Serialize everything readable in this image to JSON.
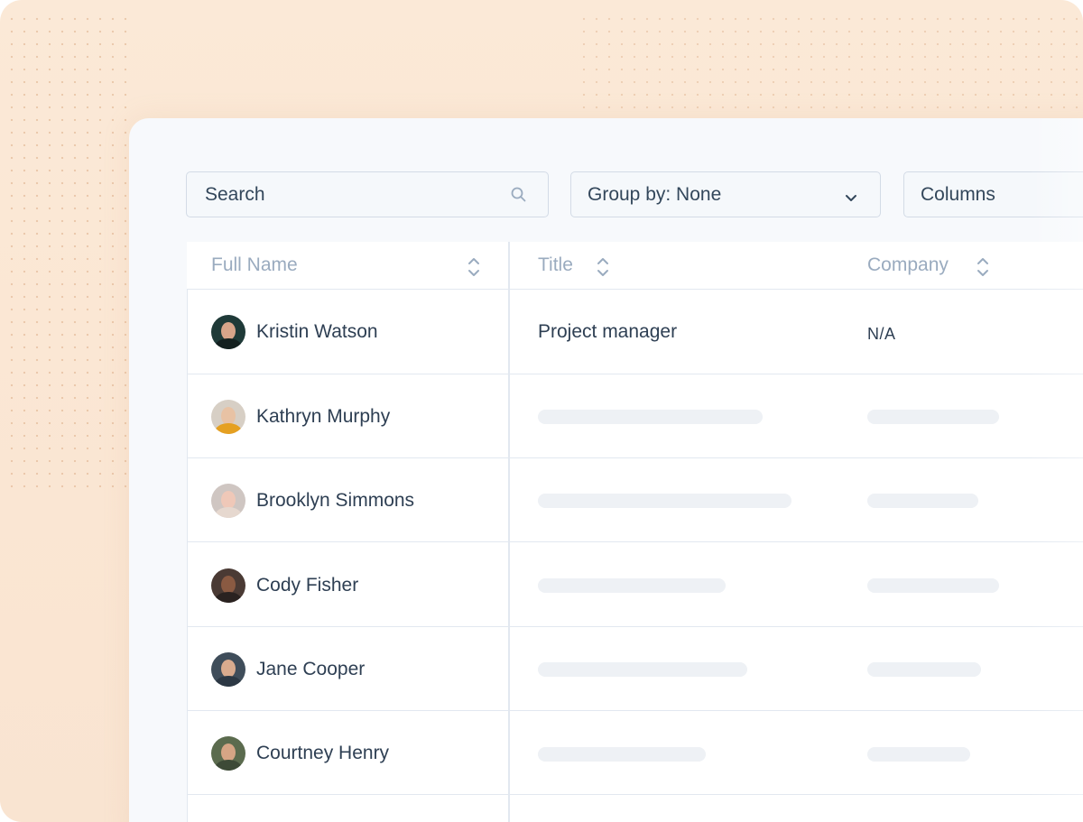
{
  "toolbar": {
    "search_label": "Search",
    "group_by_label": "Group by: None",
    "columns_label": "Columns"
  },
  "table": {
    "headers": [
      "Full Name",
      "Title",
      "Company"
    ],
    "rows": [
      {
        "name": "Kristin Watson",
        "title": "Project manager",
        "company": "N/A"
      },
      {
        "name": "Kathryn Murphy",
        "title": "",
        "company": ""
      },
      {
        "name": "Brooklyn Simmons",
        "title": "",
        "company": ""
      },
      {
        "name": "Cody Fisher",
        "title": "",
        "company": ""
      },
      {
        "name": "Jane Cooper",
        "title": "",
        "company": ""
      },
      {
        "name": "Courtney Henry",
        "title": "",
        "company": ""
      }
    ]
  },
  "colors": {
    "background": "#fbe9d7",
    "panel": "#f7f9fc",
    "border": "#d3dbe6",
    "text": "#33475b",
    "header_text": "#9aabbf",
    "skeleton": "#eef1f5"
  },
  "icons": {
    "search": "search-icon",
    "dropdown": "chevron-down-icon",
    "sort": "sort-icon"
  }
}
